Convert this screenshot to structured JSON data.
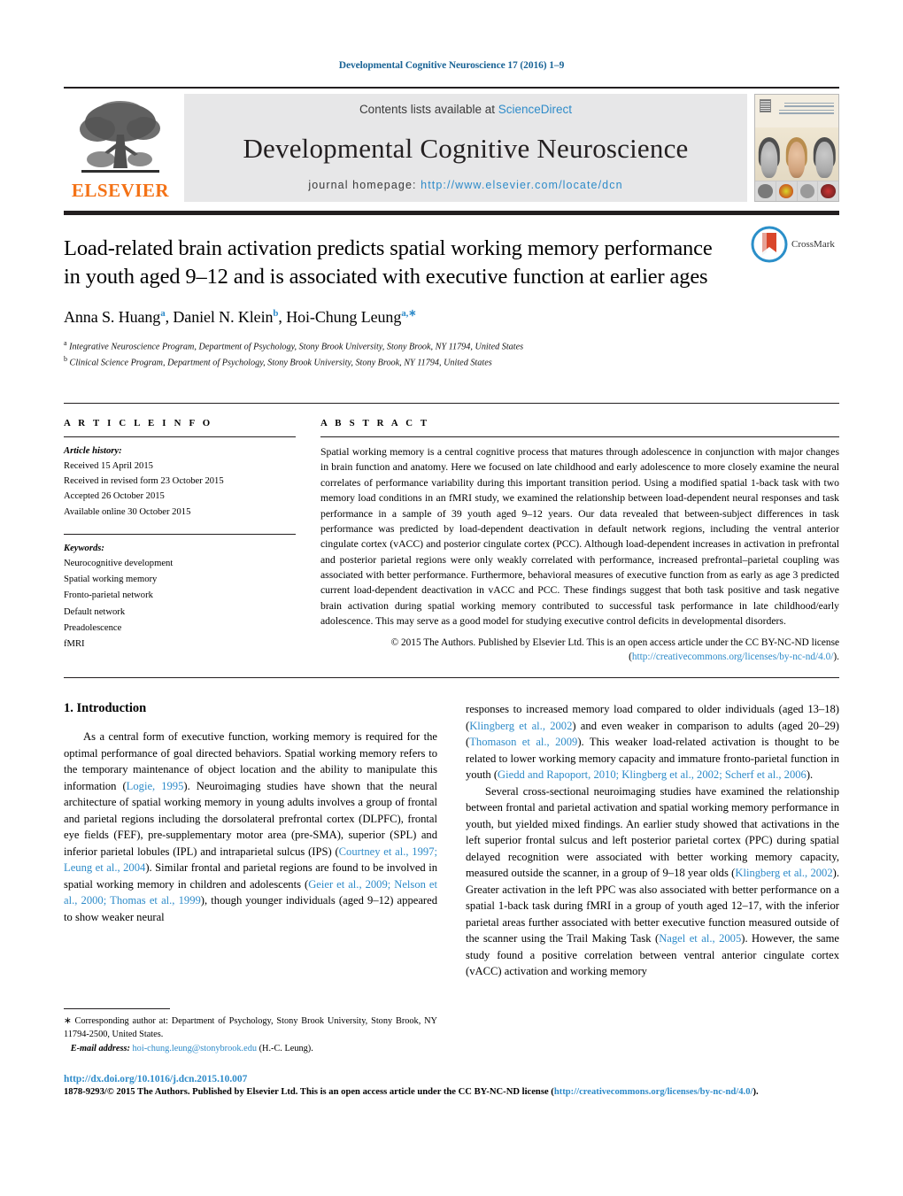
{
  "running_head": "Developmental Cognitive Neuroscience 17 (2016) 1–9",
  "masthead": {
    "publisher_name": "ELSEVIER",
    "contents_prefix": "Contents lists available at ",
    "contents_link": "ScienceDirect",
    "journal_name": "Developmental Cognitive Neuroscience",
    "homepage_prefix": "journal homepage: ",
    "homepage_url": "http://www.elsevier.com/locate/dcn",
    "cover_title_line1": "Developmental",
    "cover_title_line2": "Cognitive Neuroscience"
  },
  "title": "Load-related brain activation predicts spatial working memory performance in youth aged 9–12 and is associated with executive function at earlier ages",
  "crossmark_label": "CrossMark",
  "authors": {
    "a1_name": "Anna S. Huang",
    "a1_sup": "a",
    "sep1": ", ",
    "a2_name": "Daniel N. Klein",
    "a2_sup": "b",
    "sep2": ", ",
    "a3_name": "Hoi-Chung Leung",
    "a3_sup": "a,∗"
  },
  "affiliations": [
    {
      "mark": "a",
      "text": "Integrative Neuroscience Program, Department of Psychology, Stony Brook University, Stony Brook, NY 11794, United States"
    },
    {
      "mark": "b",
      "text": "Clinical Science Program, Department of Psychology, Stony Brook University, Stony Brook, NY 11794, United States"
    }
  ],
  "article_info": {
    "heading": "A R T I C L E   I N F O",
    "history_label": "Article history:",
    "history": [
      "Received 15 April 2015",
      "Received in revised form 23 October 2015",
      "Accepted 26 October 2015",
      "Available online 30 October 2015"
    ],
    "keywords_label": "Keywords:",
    "keywords": [
      "Neurocognitive development",
      "Spatial working memory",
      "Fronto-parietal network",
      "Default network",
      "Preadolescence",
      "fMRI"
    ]
  },
  "abstract": {
    "heading": "A B S T R A C T",
    "text": "Spatial working memory is a central cognitive process that matures through adolescence in conjunction with major changes in brain function and anatomy. Here we focused on late childhood and early adolescence to more closely examine the neural correlates of performance variability during this important transition period. Using a modified spatial 1-back task with two memory load conditions in an fMRI study, we examined the relationship between load-dependent neural responses and task performance in a sample of 39 youth aged 9–12 years. Our data revealed that between-subject differences in task performance was predicted by load-dependent deactivation in default network regions, including the ventral anterior cingulate cortex (vACC) and posterior cingulate cortex (PCC). Although load-dependent increases in activation in prefrontal and posterior parietal regions were only weakly correlated with performance, increased prefrontal–parietal coupling was associated with better performance. Furthermore, behavioral measures of executive function from as early as age 3 predicted current load-dependent deactivation in vACC and PCC. These findings suggest that both task positive and task negative brain activation during spatial working memory contributed to successful task performance in late childhood/early adolescence. This may serve as a good model for studying executive control deficits in developmental disorders.",
    "copyright_text": "© 2015 The Authors. Published by Elsevier Ltd. This is an open access article under the CC BY-NC-ND license (",
    "copyright_license_prefix": "license (",
    "license_url": "http://creativecommons.org/licenses/by-nc-nd/4.0/",
    "copyright_suffix": ")."
  },
  "body": {
    "section_number_title": "1.  Introduction",
    "left_paragraph_1_lead": "As a central form of executive function, working memory is required for the optimal performance of goal directed behaviors. Spatial working memory refers to the temporary maintenance of object location and the ability to manipulate this information (",
    "left_cite_1": "Logie, 1995",
    "left_paragraph_1_mid": "). Neuroimaging studies have shown that the neural architecture of spatial working memory in young adults involves a group of frontal and parietal regions including the dorsolateral prefrontal cortex (DLPFC), frontal eye fields (FEF), pre-supplementary motor area (pre-SMA), superior (SPL) and inferior parietal lobules (IPL) and intraparietal sulcus (IPS) (",
    "left_cite_2": "Courtney et al., 1997; Leung et al., 2004",
    "left_paragraph_1_mid2": "). Similar frontal and parietal regions are found to be involved in spatial working memory in children and adolescents (",
    "left_cite_3": "Geier et al., 2009; Nelson et al., 2000; Thomas et al., 1999",
    "left_paragraph_1_end": "), though younger individuals (aged 9–12) appeared to show weaker neural",
    "right_paragraph_1_lead": "responses to increased memory load compared to older individuals (aged 13–18) (",
    "right_cite_1": "Klingberg et al., 2002",
    "right_paragraph_1_mid": ") and even weaker in comparison to adults (aged 20–29) (",
    "right_cite_2": "Thomason et al., 2009",
    "right_paragraph_1_mid2": "). This weaker load-related activation is thought to be related to lower working memory capacity and immature fronto-parietal function in youth (",
    "right_cite_3": "Giedd and Rapoport, 2010; Klingberg et al., 2002; Scherf et al., 2006",
    "right_paragraph_1_end": ").",
    "right_paragraph_2_lead": "Several cross-sectional neuroimaging studies have examined the relationship between frontal and parietal activation and spatial working memory performance in youth, but yielded mixed findings. An earlier study showed that activations in the left superior frontal sulcus and left posterior parietal cortex (PPC) during spatial delayed recognition were associated with better working memory capacity, measured outside the scanner, in a group of 9–18 year olds (",
    "right_cite_4": "Klingberg et al., 2002",
    "right_paragraph_2_mid": "). Greater activation in the left PPC was also associated with better performance on a spatial 1-back task during fMRI in a group of youth aged 12–17, with the inferior parietal areas further associated with better executive function measured outside of the scanner using the Trail Making Task (",
    "right_cite_5": "Nagel et al., 2005",
    "right_paragraph_2_end": "). However, the same study found a positive correlation between ventral anterior cingulate cortex (vACC) activation and working memory"
  },
  "footnote": {
    "marker": "∗",
    "text": " Corresponding author at: Department of Psychology, Stony Brook University, Stony Brook, NY 11794-2500, United States.",
    "email_label": "E-mail address:",
    "email": "hoi-chung.leung@stonybrook.edu",
    "email_suffix": " (H.-C. Leung)."
  },
  "page_footer": {
    "doi": "http://dx.doi.org/10.1016/j.dcn.2015.10.007",
    "issn_line_prefix": "1878-9293/© 2015 The Authors. Published by Elsevier Ltd. This is an open access article under the CC BY-NC-ND license (",
    "issn_license_url": "http://creativecommons.org/licenses/by-nc-nd/4.0/",
    "issn_line_suffix": ")."
  },
  "colors": {
    "link_blue": "#2e8bc9",
    "elsevier_orange": "#f47216",
    "masthead_gray": "#e7e7e8",
    "rule_black": "#231f20"
  }
}
